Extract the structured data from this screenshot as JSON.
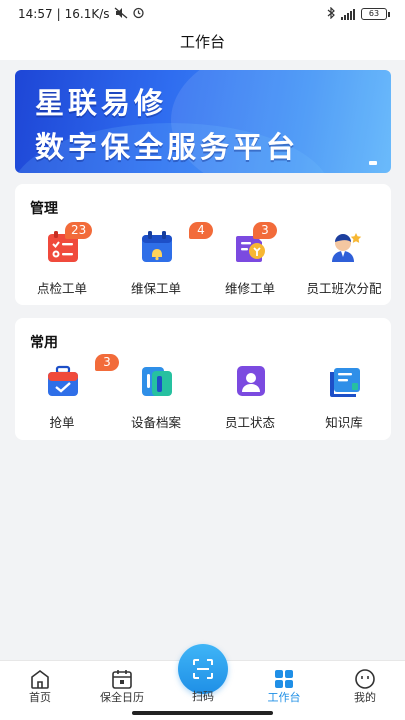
{
  "status_bar": {
    "time": "14:57",
    "speed": "16.1K/s",
    "battery": "63"
  },
  "header": {
    "title": "工作台"
  },
  "banner": {
    "line1": "星联易修",
    "line2": "数字保全服务平台"
  },
  "manage": {
    "title": "管理",
    "items": [
      {
        "label": "点检工单",
        "badge": "23",
        "icon": "checklist-icon"
      },
      {
        "label": "维保工单",
        "badge": "4",
        "icon": "maintenance-calendar-icon"
      },
      {
        "label": "维修工单",
        "badge": "3",
        "icon": "repair-order-icon"
      },
      {
        "label": "员工班次分配",
        "badge": "",
        "icon": "staff-shift-icon"
      }
    ]
  },
  "common": {
    "title": "常用",
    "items": [
      {
        "label": "抢单",
        "badge": "3",
        "icon": "grab-order-icon"
      },
      {
        "label": "设备档案",
        "badge": "",
        "icon": "device-archive-icon"
      },
      {
        "label": "员工状态",
        "badge": "",
        "icon": "staff-status-icon"
      },
      {
        "label": "知识库",
        "badge": "",
        "icon": "knowledge-base-icon"
      }
    ]
  },
  "nav": {
    "home": "首页",
    "calendar": "保全日历",
    "scan": "扫码",
    "workbench": "工作台",
    "mine": "我的",
    "active": "工作台"
  },
  "colors": {
    "accent": "#1f8fe6",
    "badge": "#f26b3a",
    "banner_start": "#1e46d6",
    "banner_end": "#5ab3fb"
  }
}
